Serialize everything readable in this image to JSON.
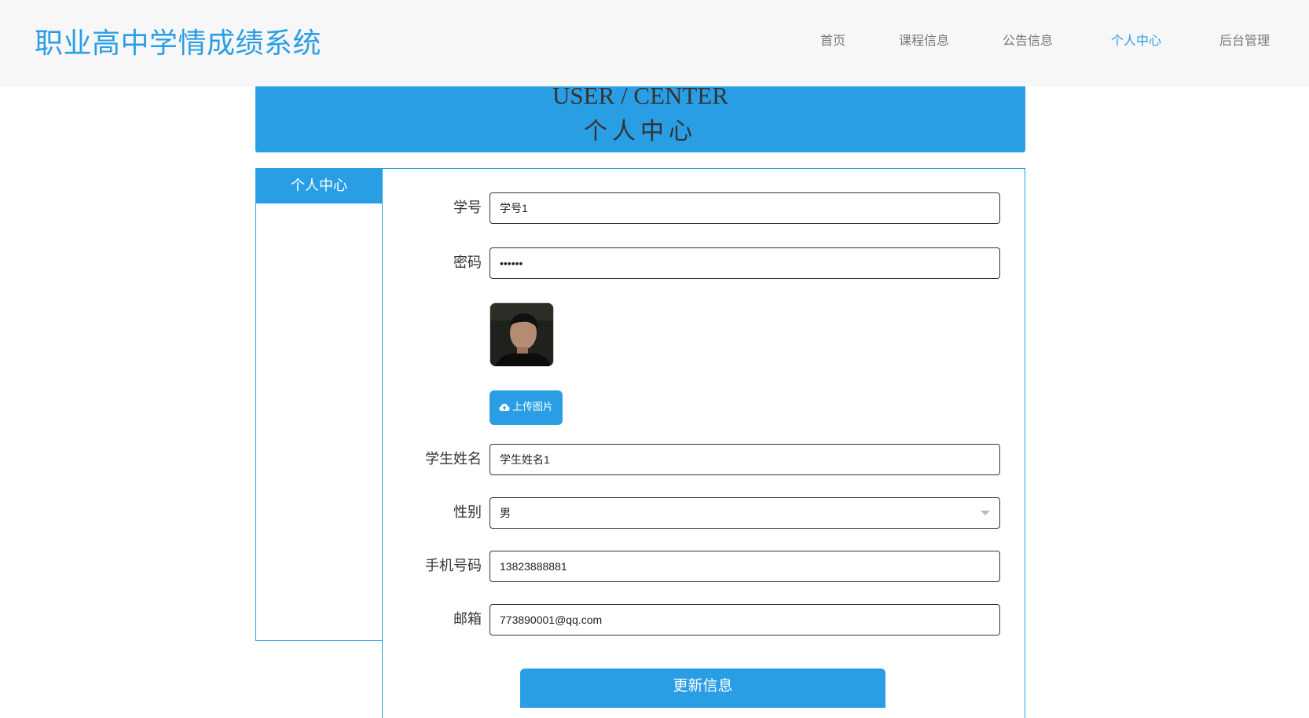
{
  "site": {
    "title": "职业高中学情成绩系统"
  },
  "nav": {
    "items": [
      {
        "label": "首页"
      },
      {
        "label": "课程信息"
      },
      {
        "label": "公告信息"
      },
      {
        "label": "个人中心"
      },
      {
        "label": "后台管理"
      }
    ],
    "active_index": 3
  },
  "banner": {
    "title_en": "USER / CENTER",
    "title_cn": "个人中心"
  },
  "sidebar": {
    "heading": "个人中心"
  },
  "form": {
    "student_id": {
      "label": "学号",
      "value": "学号1"
    },
    "password": {
      "label": "密码",
      "value": "123456"
    },
    "avatar": {
      "alt": ""
    },
    "upload": {
      "label": "上传图片"
    },
    "name": {
      "label": "学生姓名",
      "value": "学生姓名1"
    },
    "gender": {
      "label": "性别",
      "value": "男"
    },
    "phone": {
      "label": "手机号码",
      "value": "13823888881"
    },
    "email": {
      "label": "邮箱",
      "value": "773890001@qq.com"
    },
    "submit": {
      "label": "更新信息"
    }
  },
  "colors": {
    "accent": "#2a9ee5",
    "header_bg": "#f7f7f7",
    "nav_text": "#777777"
  },
  "icons": {
    "upload": "cloud-upload-icon",
    "select": "chevron-down-icon"
  }
}
